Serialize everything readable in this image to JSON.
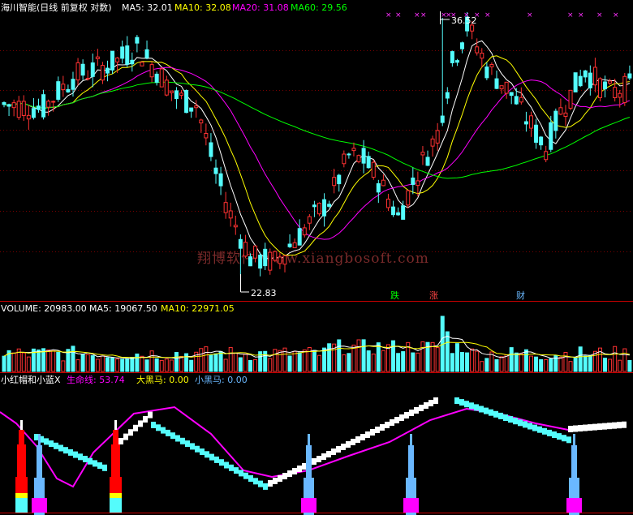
{
  "colors": {
    "up": "#ff3232",
    "down": "#54fcfc",
    "ma5": "#ffffff",
    "ma10": "#ffff00",
    "ma20": "#ff00ff",
    "ma60": "#00ff00",
    "divider": "#c80000",
    "grid": "#7a0000",
    "white": "#ffffff",
    "magenta": "#ff00ff",
    "yellow": "#ffff00",
    "red": "#ff0000",
    "cyan": "#54fcfc",
    "lightblue": "#6ab8ff",
    "purple": "#ff30ff"
  },
  "price_panel": {
    "title": "海川智能(日线 前复权 对数)",
    "indicators": [
      {
        "label": "MA5: 32.01",
        "color": "#ffffff"
      },
      {
        "label": "MA10: 32.08",
        "color": "#ffff00"
      },
      {
        "label": "MA20: 31.08",
        "color": "#ff00ff"
      },
      {
        "label": "MA60: 29.56",
        "color": "#00ff00"
      }
    ],
    "high_label": "36.52",
    "low_label": "22.83",
    "watermark": "翔博软件 www.xiangbosoft.com",
    "signals": [
      {
        "text": "跌",
        "color": "#00ff00"
      },
      {
        "text": "涨",
        "color": "#ff4444"
      },
      {
        "text": "财",
        "color": "#6ab8ff"
      }
    ]
  },
  "volume_panel": {
    "indicators": [
      {
        "label": "VOLUME: 20983.00",
        "color": "#ffffff"
      },
      {
        "label": "MA5: 19067.50",
        "color": "#ffffff"
      },
      {
        "label": "MA10: 22971.05",
        "color": "#ffff00"
      }
    ]
  },
  "indicator_panel": {
    "indicators": [
      {
        "label": "小红帽和小蓝X",
        "color": "#ffffff"
      },
      {
        "label": "生命线: 53.74",
        "color": "#ff00ff"
      },
      {
        "label": "大黑马: 0.00",
        "color": "#ffff00"
      },
      {
        "label": "小黑马: 0.00",
        "color": "#6ab8ff"
      }
    ]
  },
  "chart_data": {
    "type": "candlestick",
    "title": "海川智能(日线 前复权 对数)",
    "annotated_high": 36.52,
    "annotated_low": 22.83,
    "last_values": {
      "MA5": 32.01,
      "MA10": 32.08,
      "MA20": 31.08,
      "MA60": 29.56,
      "VOLUME": 20983.0,
      "VOL_MA5": 19067.5,
      "VOL_MA10": 22971.05,
      "生命线": 53.74,
      "大黑马": 0.0,
      "小黑马": 0.0
    }
  }
}
